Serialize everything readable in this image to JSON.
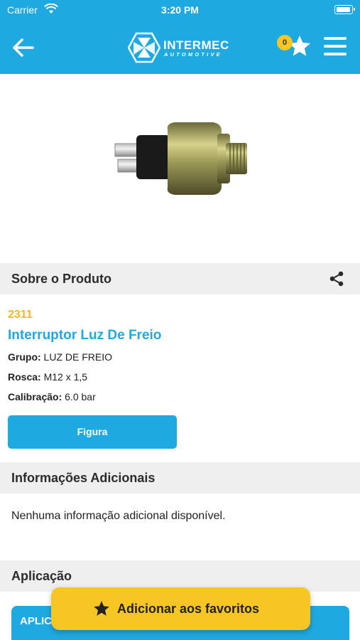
{
  "status_bar": {
    "carrier": "Carrier",
    "time": "3:20 PM"
  },
  "header": {
    "brand": "INTERMEC",
    "brand_sub": "AUTOMOTIVE",
    "favorites_count": "0",
    "accent_color": "#1fa9e1"
  },
  "about": {
    "title": "Sobre o Produto",
    "code": "2311",
    "name": "Interruptor Luz De Freio",
    "specs": [
      {
        "label": "Grupo:",
        "value": "LUZ DE FREIO"
      },
      {
        "label": "Rosca:",
        "value": "M12 x 1,5"
      },
      {
        "label": "Calibração:",
        "value": "6.0 bar"
      }
    ],
    "figure_button": "Figura"
  },
  "additional": {
    "title": "Informações Adicionais",
    "text": "Nenhuma informação adicional disponível."
  },
  "application": {
    "title": "Aplicação",
    "table_header": "APLIC"
  },
  "favorite_button": {
    "label": "Adicionar aos favoritos",
    "color": "#f6c624"
  },
  "icons": [
    "back-arrow-icon",
    "star-icon",
    "menu-icon",
    "share-icon",
    "wifi-icon",
    "battery-icon"
  ]
}
